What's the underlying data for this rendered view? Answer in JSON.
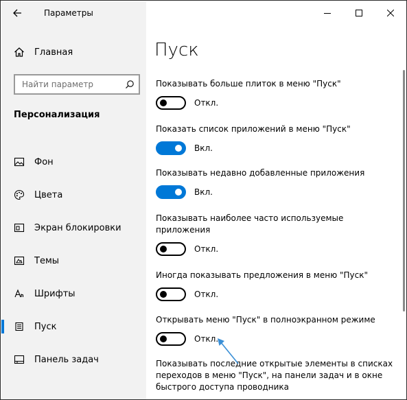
{
  "window": {
    "title": "Параметры"
  },
  "sidebar": {
    "home_label": "Главная",
    "search_placeholder": "Найти параметр",
    "section_title": "Персонализация",
    "items": [
      {
        "label": "Фон",
        "icon": "picture-icon"
      },
      {
        "label": "Цвета",
        "icon": "palette-icon"
      },
      {
        "label": "Экран блокировки",
        "icon": "lock-screen-icon"
      },
      {
        "label": "Темы",
        "icon": "themes-icon"
      },
      {
        "label": "Шрифты",
        "icon": "fonts-icon"
      },
      {
        "label": "Пуск",
        "icon": "start-icon",
        "active": true
      },
      {
        "label": "Панель задач",
        "icon": "taskbar-icon"
      }
    ]
  },
  "main": {
    "title": "Пуск",
    "settings": [
      {
        "label": "Показывать больше плиток в меню \"Пуск\"",
        "state": "Откл.",
        "on": false
      },
      {
        "label": "Показать список приложений в меню \"Пуск\"",
        "state": "Вкл.",
        "on": true
      },
      {
        "label": "Показывать недавно добавленные приложения",
        "state": "Вкл.",
        "on": true
      },
      {
        "label": "Показывать наиболее часто используемые приложения",
        "state": "Откл.",
        "on": false
      },
      {
        "label": "Иногда показывать предложения в меню \"Пуск\"",
        "state": "Откл.",
        "on": false
      },
      {
        "label": "Открывать меню \"Пуск\" в полноэкранном режиме",
        "state": "Откл.",
        "on": false
      },
      {
        "label": "Показывать последние открытые элементы в списках переходов в меню \"Пуск\", на панели задач и в окне быстрого доступа проводника"
      }
    ]
  },
  "colors": {
    "accent": "#0078d7",
    "sidebar_bg": "#f2f2f2",
    "annotation": "#3a8fd6"
  }
}
